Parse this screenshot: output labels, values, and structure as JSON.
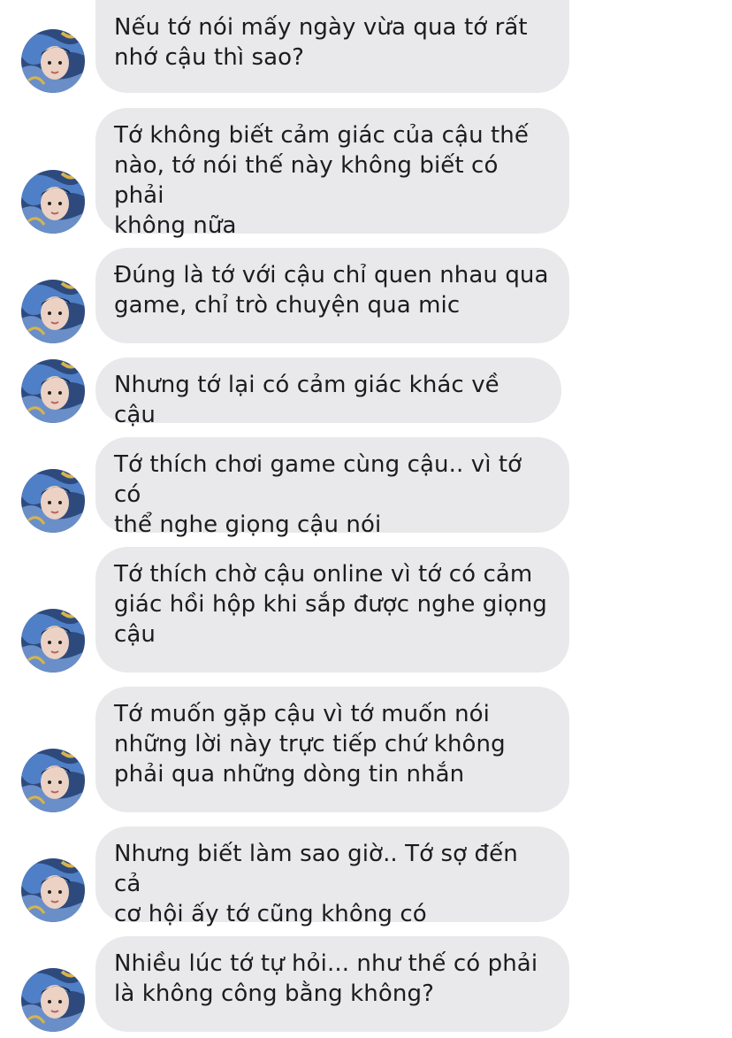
{
  "conversation": {
    "messages": [
      {
        "text": "Nếu tớ nói mấy ngày vừa qua tớ rất\nnhớ cậu thì sao?"
      },
      {
        "text": "Tớ không biết cảm giác của cậu thế\nnào, tớ nói thế này không biết có phải\nkhông nữa"
      },
      {
        "text": "Đúng là tớ với cậu chỉ quen nhau qua\ngame, chỉ trò chuyện qua mic"
      },
      {
        "text": "Nhưng tớ lại có cảm giác khác về cậu"
      },
      {
        "text": "Tớ thích chơi game cùng cậu.. vì tớ có\nthể nghe giọng cậu nói"
      },
      {
        "text": "Tớ thích chờ cậu online vì tớ có cảm\ngiác hồi hộp khi sắp được nghe giọng\ncậu"
      },
      {
        "text": "Tớ muốn gặp cậu vì tớ muốn nói\nnhững lời này trực tiếp chứ không\nphải qua những dòng tin nhắn"
      },
      {
        "text": "Nhưng biết làm sao giờ.. Tớ sợ đến cả\ncơ hội ấy tớ cũng không có"
      },
      {
        "text": "Nhiều lúc tớ tự hỏi... như thế có phải\nlà không công bằng không?"
      }
    ]
  },
  "colors": {
    "bubble_background": "#e9e9eb",
    "text": "#1c1c1e",
    "page_background": "#ffffff"
  },
  "icons": {
    "avatar": "contact-avatar-icon"
  }
}
